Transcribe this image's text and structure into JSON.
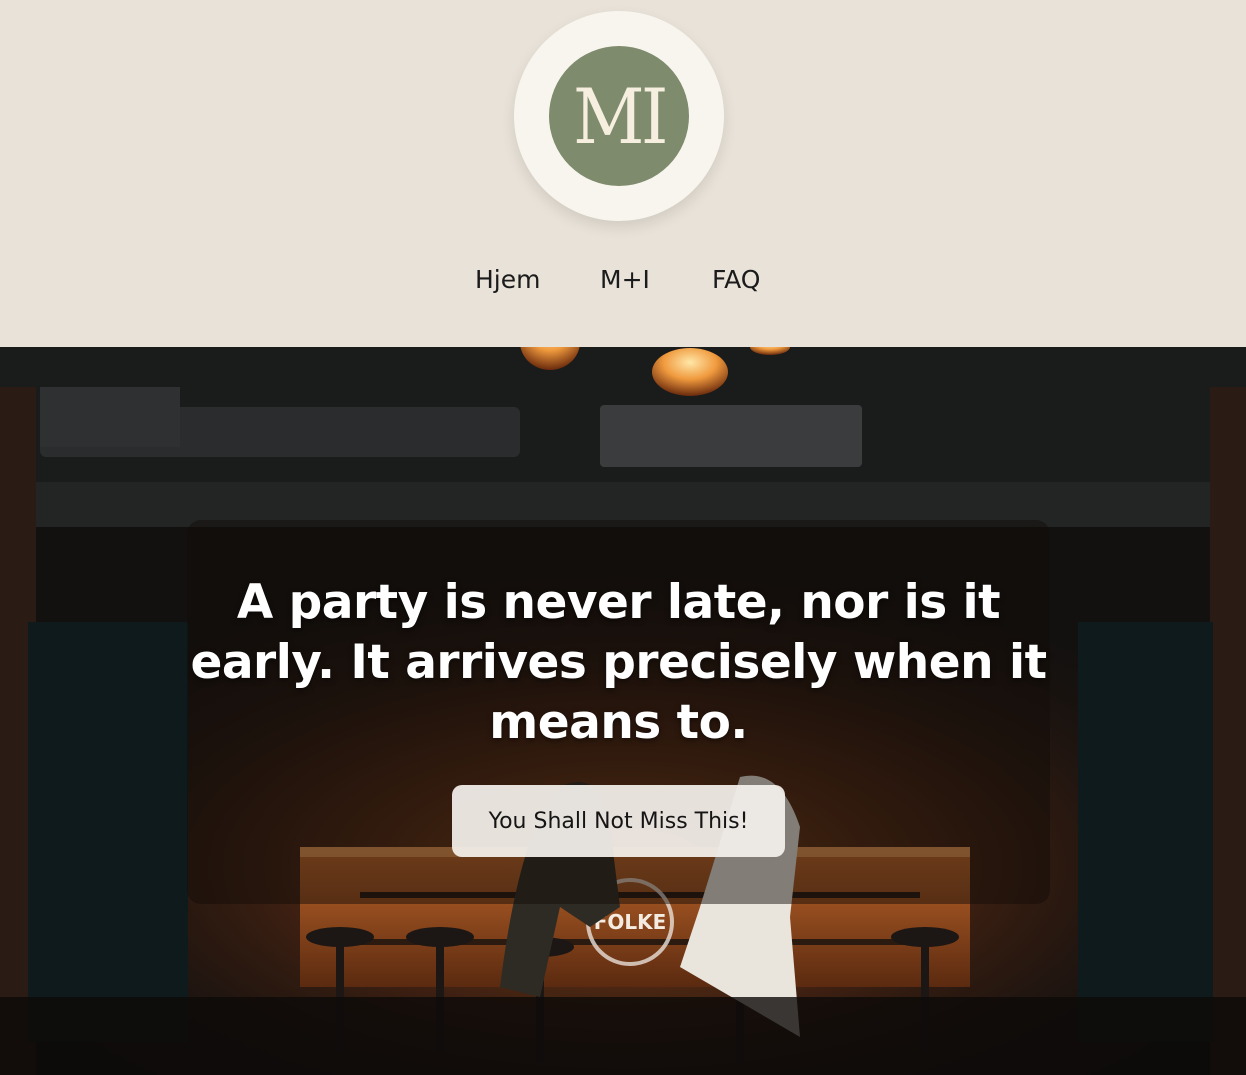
{
  "header": {
    "logo_text": "MI",
    "nav": [
      {
        "label": "Hjem"
      },
      {
        "label": "M+I"
      },
      {
        "label": "FAQ"
      }
    ]
  },
  "hero": {
    "headline": "A party is never late, nor is it early. It arrives precisely when it means to.",
    "cta_label": "You Shall Not Miss This!",
    "sign_text": "FOLKE"
  },
  "colors": {
    "background": "#e8e2d8",
    "logo_ring": "#f8f5ee",
    "logo_fill": "#7e8b6c",
    "logo_text": "#f6efe0",
    "cta_background": "#f4f0ec"
  }
}
